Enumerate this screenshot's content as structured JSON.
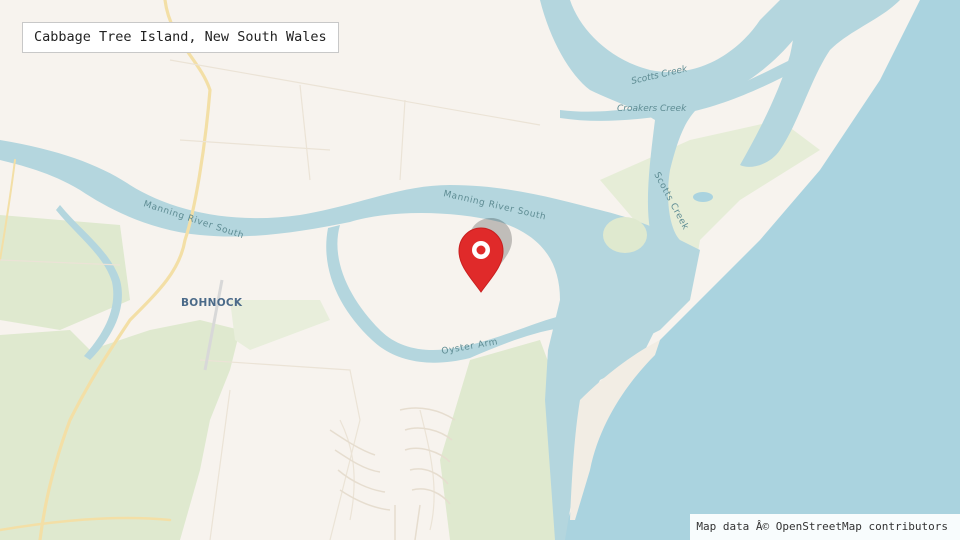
{
  "title": "Cabbage Tree Island, New South Wales",
  "attribution": "Map data Â© OpenStreetMap contributors",
  "labels": {
    "manning_river_south_west": "Manning River South",
    "manning_river_south_east": "Manning River South",
    "oyster_arm": "Oyster Arm",
    "scotts_creek_top": "Scotts Creek",
    "croakers_creek": "Croakers Creek",
    "scotts_creek_side": "Scotts Creek",
    "bohnock": "BOHNOCK"
  },
  "marker": {
    "icon": "map-pin-icon",
    "color": "#e02a2a"
  },
  "colors": {
    "land": "#f7f3ee",
    "water": "#aad3df",
    "water_dark": "#b4d6de",
    "green": "#dfe9cf",
    "road": "#f2e3b3"
  }
}
